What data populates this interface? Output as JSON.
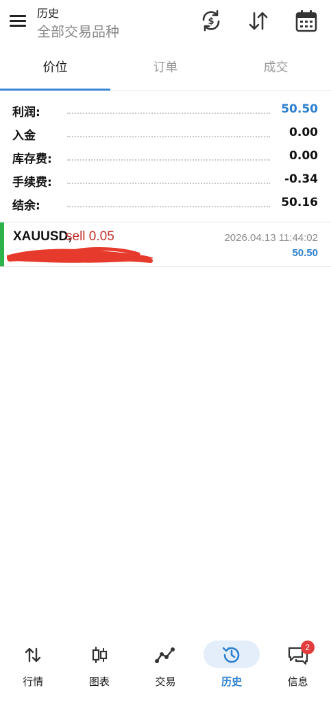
{
  "header": {
    "title": "历史",
    "subtitle": "全部交易品种",
    "icons": [
      "sync-currency-icon",
      "sort-icon",
      "calendar-icon"
    ]
  },
  "tabs": [
    {
      "label": "价位",
      "active": true
    },
    {
      "label": "订单",
      "active": false
    },
    {
      "label": "成交",
      "active": false
    }
  ],
  "summary": [
    {
      "label": "利润:",
      "value": "50.50",
      "highlight": true
    },
    {
      "label": "入金",
      "value": "0.00",
      "highlight": false
    },
    {
      "label": "库存费:",
      "value": "0.00",
      "highlight": false
    },
    {
      "label": "手续费:",
      "value": "-0.34",
      "highlight": false
    },
    {
      "label": "结余:",
      "value": "50.16",
      "highlight": false
    }
  ],
  "trade": {
    "symbol": "XAUUSD,",
    "side": "sell 0.05",
    "time": "2026.04.13 11:44:02",
    "profit": "50.50"
  },
  "bottom_nav": [
    {
      "label": "行情",
      "icon": "quotes-arrows-icon",
      "active": false
    },
    {
      "label": "图表",
      "icon": "candlestick-chart-icon",
      "active": false
    },
    {
      "label": "交易",
      "icon": "trade-line-icon",
      "active": false
    },
    {
      "label": "历史",
      "icon": "history-clock-icon",
      "active": true
    },
    {
      "label": "信息",
      "icon": "messages-icon",
      "active": false,
      "badge": "2"
    }
  ],
  "colors": {
    "accent": "#2c7fd0",
    "sell": "#c2302d",
    "buy_bar": "#2eb34c",
    "badge": "#e23c3c"
  }
}
